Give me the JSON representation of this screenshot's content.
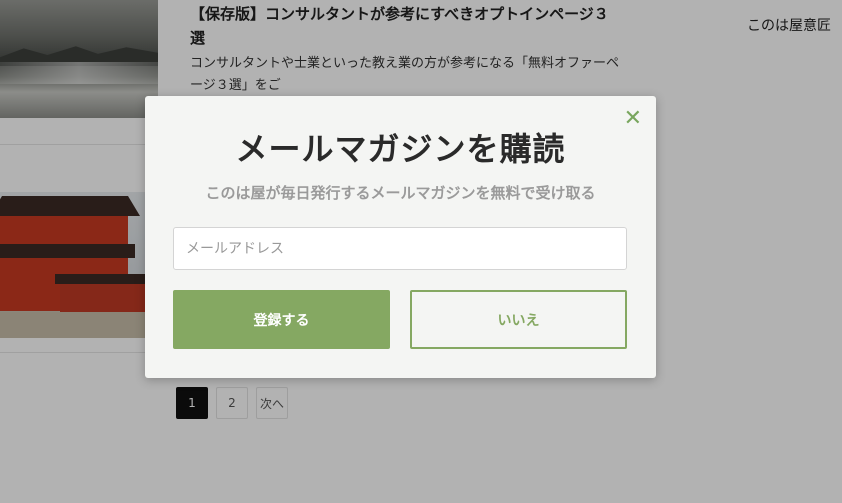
{
  "background": {
    "post": {
      "title": "【保存版】コンサルタントが参考にすべきオプトインページ３選",
      "excerpt": "コンサルタントや士業といった教え業の方が参考になる「無料オファーページ３選」をご"
    },
    "sidebar_text": "このは屋意匠",
    "pagination": [
      "1",
      "2",
      "次へ"
    ],
    "active_page": "1"
  },
  "modal": {
    "title": "メールマガジンを購読",
    "subtitle": "このは屋が毎日発行するメールマガジンを無料で受け取る",
    "email_placeholder": "メールアドレス",
    "email_value": "",
    "subscribe_label": "登録する",
    "decline_label": "いいえ",
    "close_icon": "close-icon"
  },
  "colors": {
    "accent": "#85a862",
    "modal_bg": "#f4f5f3",
    "overlay": "rgba(0,0,0,0.30)"
  }
}
